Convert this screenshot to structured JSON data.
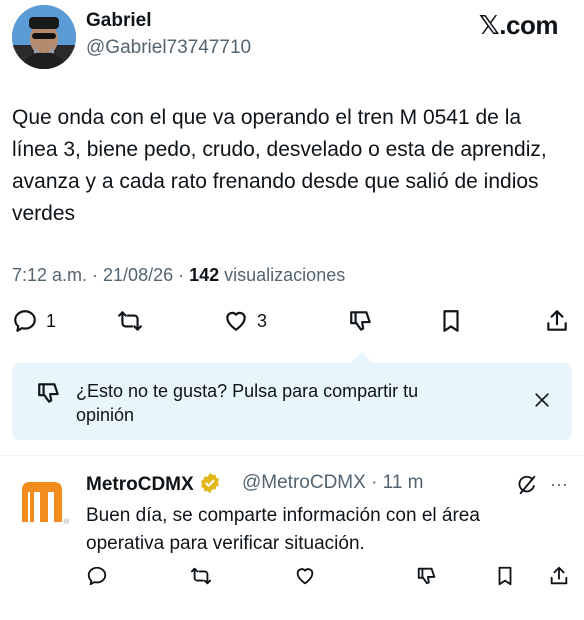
{
  "author": {
    "name": "Gabriel",
    "handle": "@Gabriel73747710"
  },
  "brand": "𝕏.com",
  "tweet": {
    "text": "Que onda con el que va operando el tren M 0541 de la línea 3, biene pedo, crudo, desvelado o esta de aprendiz, avanza y a cada rato frenando desde que salió de indios verdes",
    "time": "7:12 a.m. · 21/08/26 · ",
    "views_count": "142",
    "views_label": " visualizaciones"
  },
  "actions": {
    "replies": "1",
    "likes": "3"
  },
  "banner": {
    "text": "¿Esto no te gusta? Pulsa para compartir tu opinión"
  },
  "reply": {
    "name": "MetroCDMX",
    "handle": "@MetroCDMX · 11 m",
    "text": "Buen día, se comparte información con el área operativa para verificar situación.",
    "more": "···"
  },
  "colors": {
    "accent": "#1d9bf0",
    "banner_bg": "#e8f5fd",
    "metro_orange": "#f28c1e",
    "verified_gold": "#e2b719"
  }
}
